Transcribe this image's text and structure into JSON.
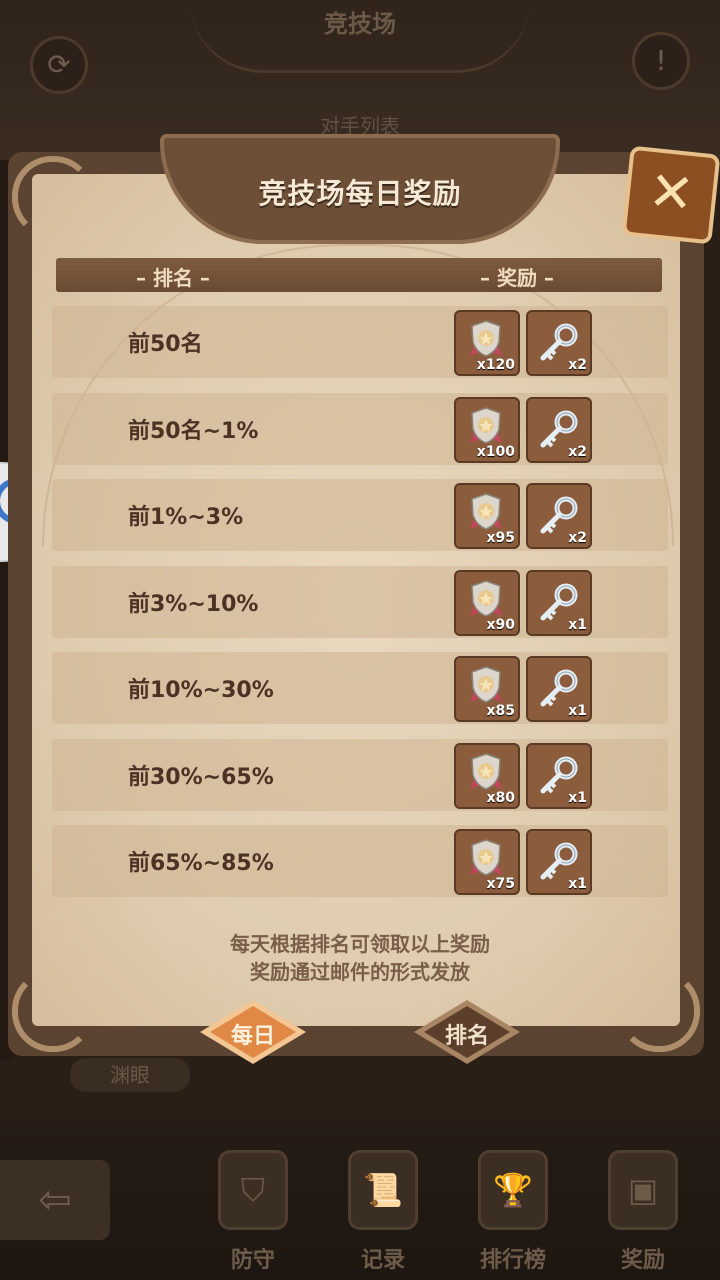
{
  "background": {
    "title": "竞技场",
    "subtitle": "对手列表",
    "deep_eye_label": "渊眼",
    "nav": [
      {
        "label": "防守",
        "icon": "shield-icon"
      },
      {
        "label": "记录",
        "icon": "scroll-icon"
      },
      {
        "label": "排行榜",
        "icon": "trophy-icon"
      },
      {
        "label": "奖励",
        "icon": "chest-icon"
      }
    ]
  },
  "dialog": {
    "title": "竞技场每日奖励",
    "column_rank": "– 排名 –",
    "column_reward": "– 奖励 –",
    "rows": [
      {
        "rank": "前50名",
        "medal": "x120",
        "key": "x2"
      },
      {
        "rank": "前50名~1%",
        "medal": "x100",
        "key": "x2"
      },
      {
        "rank": "前1%~3%",
        "medal": "x95",
        "key": "x2"
      },
      {
        "rank": "前3%~10%",
        "medal": "x90",
        "key": "x1"
      },
      {
        "rank": "前10%~30%",
        "medal": "x85",
        "key": "x1"
      },
      {
        "rank": "前30%~65%",
        "medal": "x80",
        "key": "x1"
      },
      {
        "rank": "前65%~85%",
        "medal": "x75",
        "key": "x1"
      }
    ],
    "note_line1": "每天根据排名可领取以上奖励",
    "note_line2": "奖励通过邮件的形式发放",
    "tabs": [
      {
        "label": "每日",
        "active": true
      },
      {
        "label": "排名",
        "active": false
      }
    ]
  },
  "colors": {
    "panel_frame": "#5a4330",
    "parchment": "#e3d0b3",
    "active_tab": "#e38b4a",
    "inactive_tab": "#5a3e2a"
  }
}
